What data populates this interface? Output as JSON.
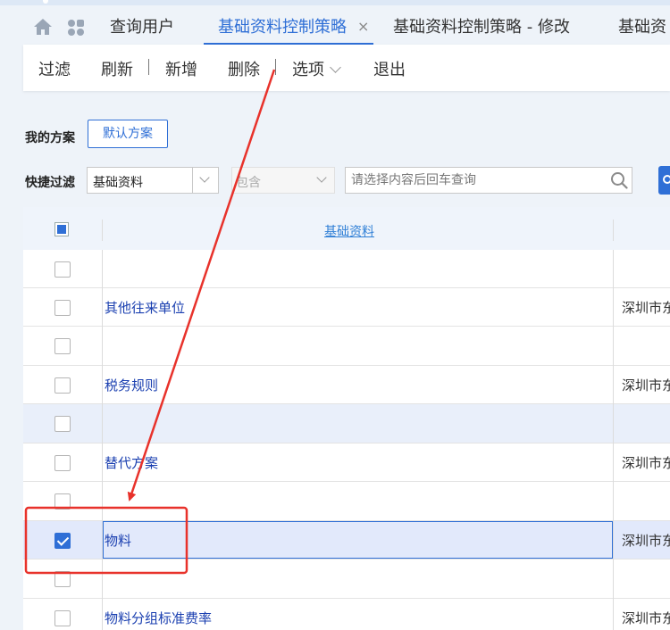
{
  "tabs": [
    {
      "label": "查询用户",
      "active": false
    },
    {
      "label": "基础资料控制策略",
      "active": true
    },
    {
      "label": "基础资料控制策略 - 修改",
      "active": false
    },
    {
      "label": "基础资",
      "active": false
    }
  ],
  "toolbar": {
    "filter": "过滤",
    "refresh": "刷新",
    "add": "新增",
    "delete": "删除",
    "options": "选项",
    "exit": "退出"
  },
  "plan": {
    "label": "我的方案",
    "default_button": "默认方案"
  },
  "quick_filter": {
    "label": "快捷过滤",
    "field_value": "基础资料",
    "operator_value": "包含",
    "search_placeholder": "请选择内容后回车查询"
  },
  "grid": {
    "header_column": "基础资料",
    "rows": [
      {
        "name": "",
        "org": "",
        "checked": false
      },
      {
        "name": "其他往来单位",
        "org": "深圳市东",
        "checked": false
      },
      {
        "name": "",
        "org": "",
        "checked": false
      },
      {
        "name": "税务规则",
        "org": "深圳市东",
        "checked": false
      },
      {
        "name": "",
        "org": "",
        "checked": false
      },
      {
        "name": "替代方案",
        "org": "深圳市东",
        "checked": false
      },
      {
        "name": "",
        "org": "",
        "checked": false
      },
      {
        "name": "物料",
        "org": "深圳市东",
        "checked": true
      },
      {
        "name": "",
        "org": "",
        "checked": false
      },
      {
        "name": "物料分组标准费率",
        "org": "深圳市东",
        "checked": false
      }
    ]
  },
  "colors": {
    "accent": "#2f6fd6",
    "annotation": "#e8322b"
  }
}
